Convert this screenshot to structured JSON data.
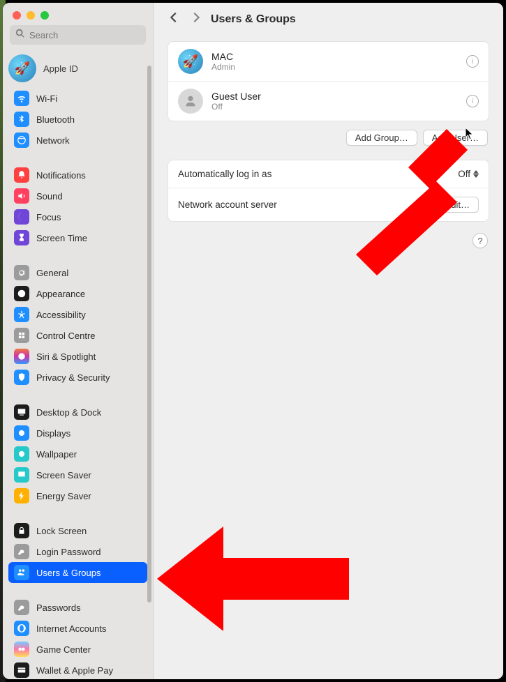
{
  "header": {
    "title": "Users & Groups"
  },
  "search": {
    "placeholder": "Search"
  },
  "apple_id": {
    "label": "Apple ID",
    "emoji": "🚀"
  },
  "sidebar": {
    "groups": [
      [
        {
          "label": "Wi-Fi",
          "bg": "#1f8fff",
          "name": "wifi"
        },
        {
          "label": "Bluetooth",
          "bg": "#1f8fff",
          "name": "bluetooth"
        },
        {
          "label": "Network",
          "bg": "#1f8fff",
          "name": "network"
        }
      ],
      [
        {
          "label": "Notifications",
          "bg": "#ff4040",
          "name": "notifications"
        },
        {
          "label": "Sound",
          "bg": "#ff4060",
          "name": "sound"
        },
        {
          "label": "Focus",
          "bg": "#6f46d8",
          "name": "focus"
        },
        {
          "label": "Screen Time",
          "bg": "#6f46d8",
          "name": "screen-time"
        }
      ],
      [
        {
          "label": "General",
          "bg": "#9b9b9b",
          "name": "general"
        },
        {
          "label": "Appearance",
          "bg": "#1c1c1c",
          "name": "appearance"
        },
        {
          "label": "Accessibility",
          "bg": "#1f8fff",
          "name": "accessibility"
        },
        {
          "label": "Control Centre",
          "bg": "#9b9b9b",
          "name": "control-centre"
        },
        {
          "label": "Siri & Spotlight",
          "bg": "linear-gradient(#e74,#c3a,#39f)",
          "name": "siri-spotlight"
        },
        {
          "label": "Privacy & Security",
          "bg": "#1f8fff",
          "name": "privacy-security"
        }
      ],
      [
        {
          "label": "Desktop & Dock",
          "bg": "#1c1c1c",
          "name": "desktop-dock"
        },
        {
          "label": "Displays",
          "bg": "#1f8fff",
          "name": "displays"
        },
        {
          "label": "Wallpaper",
          "bg": "#25c9c9",
          "name": "wallpaper"
        },
        {
          "label": "Screen Saver",
          "bg": "#25c9c9",
          "name": "screen-saver"
        },
        {
          "label": "Energy Saver",
          "bg": "#ffb000",
          "name": "energy-saver"
        }
      ],
      [
        {
          "label": "Lock Screen",
          "bg": "#1c1c1c",
          "name": "lock-screen"
        },
        {
          "label": "Login Password",
          "bg": "#9b9b9b",
          "name": "login-password"
        },
        {
          "label": "Users & Groups",
          "bg": "#1f8fff",
          "name": "users-groups",
          "selected": true
        }
      ],
      [
        {
          "label": "Passwords",
          "bg": "#9b9b9b",
          "name": "passwords"
        },
        {
          "label": "Internet Accounts",
          "bg": "#1f8fff",
          "name": "internet-accounts"
        },
        {
          "label": "Game Center",
          "bg": "linear-gradient(#7cf,#f7a,#fd5)",
          "name": "game-center"
        },
        {
          "label": "Wallet & Apple Pay",
          "bg": "#1c1c1c",
          "name": "wallet-apple-pay"
        }
      ]
    ]
  },
  "users": [
    {
      "name": "MAC",
      "sub": "Admin",
      "kind": "rocket"
    },
    {
      "name": "Guest User",
      "sub": "Off",
      "kind": "guest"
    }
  ],
  "buttons": {
    "add_group": "Add Group…",
    "add_user": "Add User…",
    "edit": "Edit…"
  },
  "settings": {
    "auto_login_label": "Automatically log in as",
    "auto_login_value": "Off",
    "network_server_label": "Network account server"
  },
  "help": "?"
}
